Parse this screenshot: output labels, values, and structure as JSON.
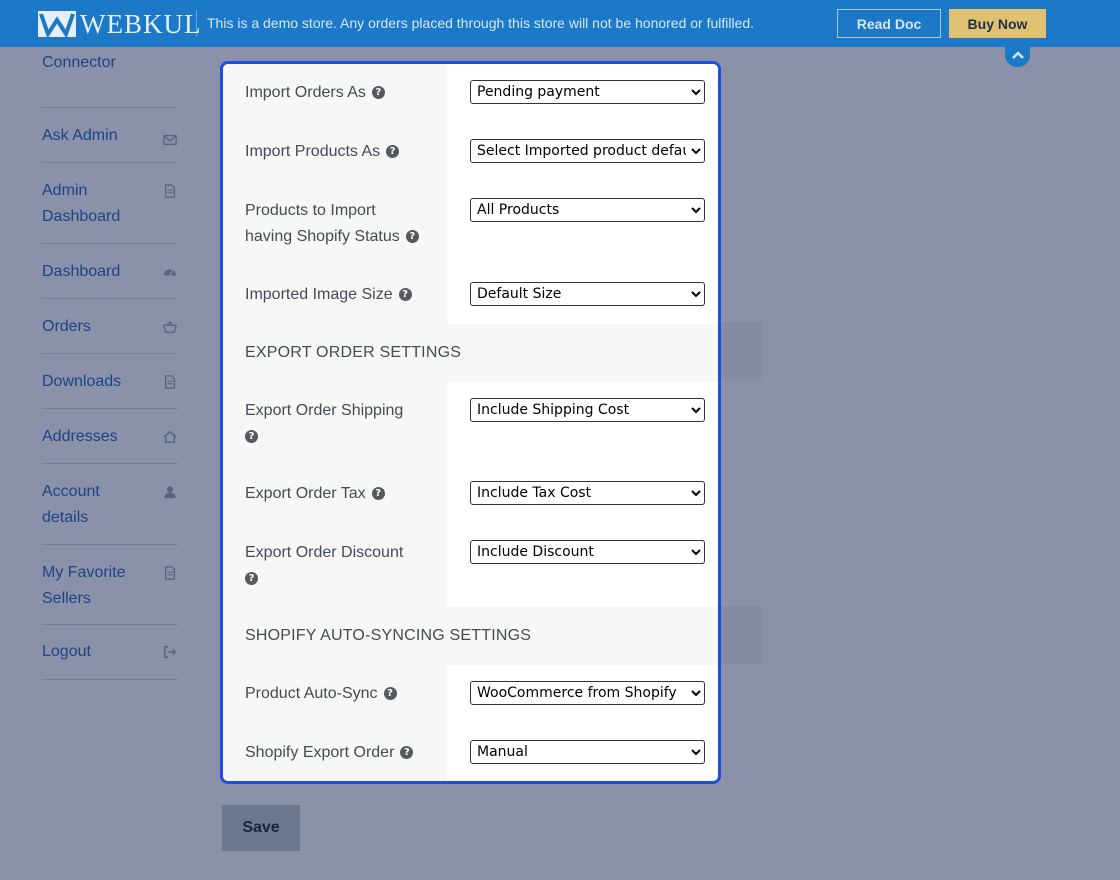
{
  "topbar": {
    "logo_text": "WEBKUL",
    "demo_message": "This is a demo store. Any orders placed through this store will not be honored or fulfilled.",
    "read_doc": "Read Doc",
    "buy_now": "Buy Now",
    "accent_color": "#1b79c7",
    "buy_color": "#e0c171"
  },
  "sidebar": {
    "items": [
      {
        "label": "Connector",
        "icon": "none"
      },
      {
        "label": "Ask Admin",
        "icon": "envelope-icon"
      },
      {
        "label": "Admin Dashboard",
        "icon": "file-icon"
      },
      {
        "label": "Dashboard",
        "icon": "tachometer-icon"
      },
      {
        "label": "Orders",
        "icon": "basket-icon"
      },
      {
        "label": "Downloads",
        "icon": "file-icon"
      },
      {
        "label": "Addresses",
        "icon": "home-icon"
      },
      {
        "label": "Account details",
        "icon": "user-icon"
      },
      {
        "label": "My Favorite Sellers",
        "icon": "file-icon"
      },
      {
        "label": "Logout",
        "icon": "sign-out-icon"
      }
    ]
  },
  "settings": {
    "import_orders_as": {
      "label": "Import Orders As",
      "value": "Pending payment"
    },
    "import_products_as": {
      "label": "Import Products As",
      "value": "Select Imported product default"
    },
    "products_status": {
      "label_line1": "Products to Import",
      "label_line2": "having Shopify Status",
      "value": "All Products"
    },
    "image_size": {
      "label": "Imported Image Size",
      "value": "Default Size"
    },
    "export_section_title": "EXPORT ORDER SETTINGS",
    "export_shipping": {
      "label": "Export Order Shipping",
      "value": "Include Shipping Cost"
    },
    "export_tax": {
      "label": "Export Order Tax",
      "value": "Include Tax Cost"
    },
    "export_discount": {
      "label": "Export Order Discount",
      "value": "Include Discount"
    },
    "sync_section_title": "SHOPIFY AUTO-SYNCING SETTINGS",
    "product_auto_sync": {
      "label": "Product Auto-Sync",
      "value": "WooCommerce from Shopify"
    },
    "shopify_export_order": {
      "label": "Shopify Export Order",
      "value": "Manual"
    },
    "help_glyph": "?"
  },
  "save_label": "Save",
  "highlight_color": "#1d4ee3"
}
